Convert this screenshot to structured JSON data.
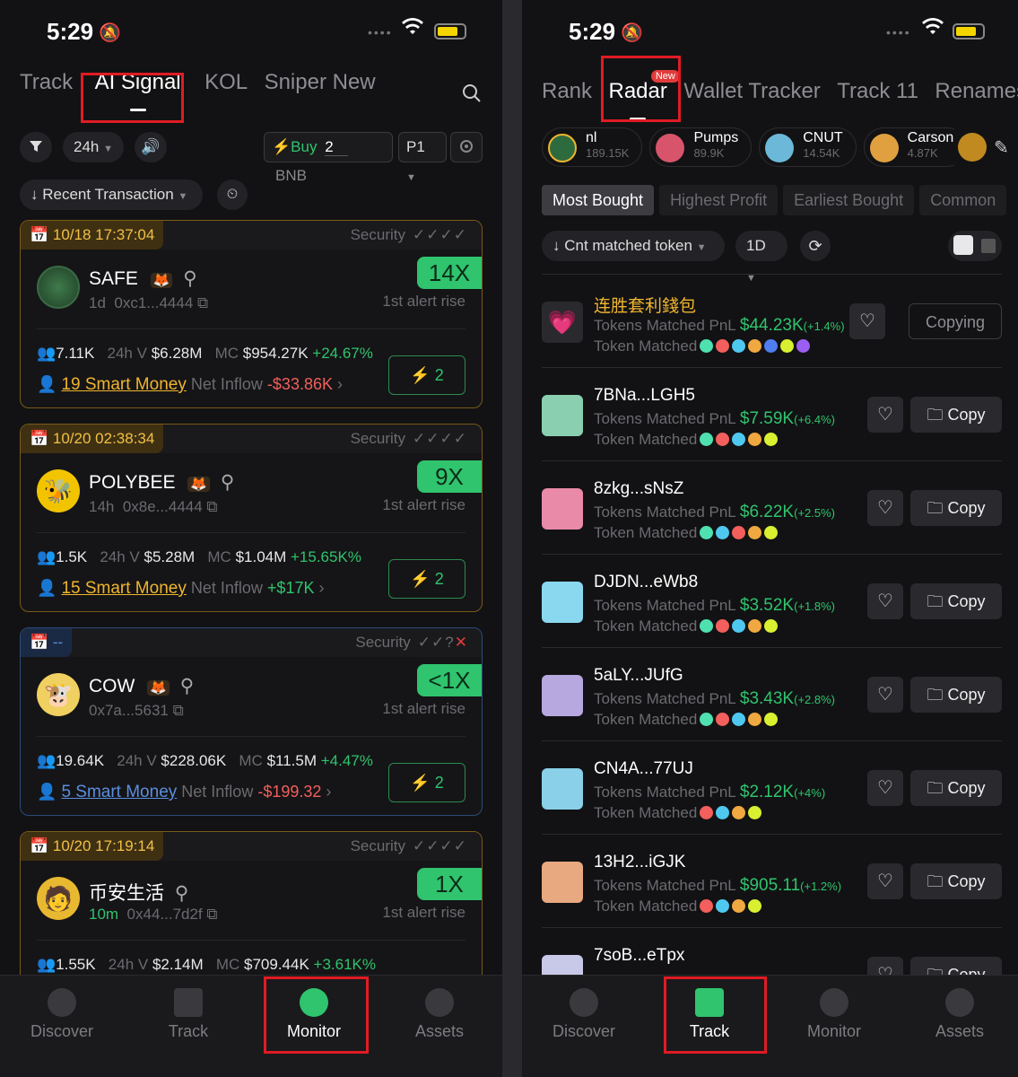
{
  "left": {
    "status": {
      "time": "5:29"
    },
    "tabs": [
      {
        "label": "Track"
      },
      {
        "label": "AI Signal"
      },
      {
        "label": "KOL"
      },
      {
        "label": "Sniper New"
      }
    ],
    "controls": {
      "period": "24h",
      "buy_label": "Buy",
      "buy_amount": "2",
      "buy_unit": "BNB",
      "preset": "P1",
      "sort": "Recent Transaction"
    },
    "cards": [
      {
        "date": "10/18 17:37:04",
        "security_label": "Security",
        "checks": "✓✓✓✓",
        "name": "SAFE",
        "age": "1d",
        "address": "0xc1...4444",
        "multiplier": "14X",
        "alert": "1st alert rise",
        "holders": "7.11K",
        "vol_label": "24h V",
        "vol": "$6.28M",
        "mc_label": "MC",
        "mc": "$954.27K",
        "change": "+24.67%",
        "smart": "19 Smart Money",
        "inflow_label": "Net Inflow",
        "inflow": "-$33.86K",
        "btn": "2"
      },
      {
        "date": "10/20 02:38:34",
        "security_label": "Security",
        "checks": "✓✓✓✓",
        "name": "POLYBEE",
        "age": "14h",
        "address": "0x8e...4444",
        "multiplier": "9X",
        "alert": "1st alert rise",
        "holders": "1.5K",
        "vol_label": "24h V",
        "vol": "$5.28M",
        "mc_label": "MC",
        "mc": "$1.04M",
        "change": "+15.65K%",
        "smart": "15 Smart Money",
        "inflow_label": "Net Inflow",
        "inflow": "+$17K",
        "btn": "2"
      },
      {
        "date": "--",
        "security_label": "Security",
        "checks": "✓✓?",
        "name": "COW",
        "age": "",
        "address": "0x7a...5631",
        "multiplier": "<1X",
        "alert": "1st alert rise",
        "holders": "19.64K",
        "vol_label": "24h V",
        "vol": "$228.06K",
        "mc_label": "MC",
        "mc": "$11.5M",
        "change": "+4.47%",
        "smart": "5 Smart Money",
        "inflow_label": "Net Inflow",
        "inflow": "-$199.32",
        "btn": "2"
      },
      {
        "date": "10/20 17:19:14",
        "security_label": "Security",
        "checks": "✓✓✓✓",
        "name": "币安生活",
        "age": "10m",
        "address": "0x44...7d2f",
        "multiplier": "1X",
        "alert": "1st alert rise",
        "holders": "1.55K",
        "vol_label": "24h V",
        "vol": "$2.14M",
        "mc_label": "MC",
        "mc": "$709.44K",
        "change": "+3.61K%"
      }
    ],
    "nav": [
      {
        "label": "Discover"
      },
      {
        "label": "Track"
      },
      {
        "label": "Monitor"
      },
      {
        "label": "Assets"
      }
    ]
  },
  "right": {
    "status": {
      "time": "5:29"
    },
    "tabs": [
      {
        "label": "Rank"
      },
      {
        "label": "Radar",
        "badge": "New"
      },
      {
        "label": "Wallet Tracker"
      },
      {
        "label": "Track 11"
      },
      {
        "label": "Renames"
      }
    ],
    "kols": [
      {
        "name": "nl",
        "count": "189.15K"
      },
      {
        "name": "Pumps",
        "count": "89.9K"
      },
      {
        "name": "CNUT",
        "count": "14.54K"
      },
      {
        "name": "Carson",
        "count": "4.87K"
      }
    ],
    "filters": [
      "Most Bought",
      "Highest Profit",
      "Earliest Bought",
      "Common"
    ],
    "sort": "Cnt matched token",
    "period": "1D",
    "row_labels": {
      "pnl": "Tokens Matched PnL",
      "matched": "Token Matched"
    },
    "rows": [
      {
        "name": "连胜套利錢包",
        "pnl": "$44.23K",
        "pct": "(+1.4%)",
        "action": "Copying"
      },
      {
        "name": "7BNa...LGH5",
        "pnl": "$7.59K",
        "pct": "(+6.4%)",
        "action": "Copy"
      },
      {
        "name": "8zkg...sNsZ",
        "pnl": "$6.22K",
        "pct": "(+2.5%)",
        "action": "Copy"
      },
      {
        "name": "DJDN...eWb8",
        "pnl": "$3.52K",
        "pct": "(+1.8%)",
        "action": "Copy"
      },
      {
        "name": "5aLY...JUfG",
        "pnl": "$3.43K",
        "pct": "(+2.8%)",
        "action": "Copy"
      },
      {
        "name": "CN4A...77UJ",
        "pnl": "$2.12K",
        "pct": "(+4%)",
        "action": "Copy"
      },
      {
        "name": "13H2...iGJK",
        "pnl": "$905.11",
        "pct": "(+1.2%)",
        "action": "Copy"
      },
      {
        "name": "7soB...eTpx",
        "pnl": "",
        "pct": "",
        "action": "Copy"
      }
    ],
    "nav": [
      {
        "label": "Discover"
      },
      {
        "label": "Track"
      },
      {
        "label": "Monitor"
      },
      {
        "label": "Assets"
      }
    ]
  },
  "colors": {
    "accent_green": "#2fc46d",
    "gold": "#f0b52e",
    "highlight_red": "#e01b24",
    "loss_red": "#f25f5c"
  }
}
